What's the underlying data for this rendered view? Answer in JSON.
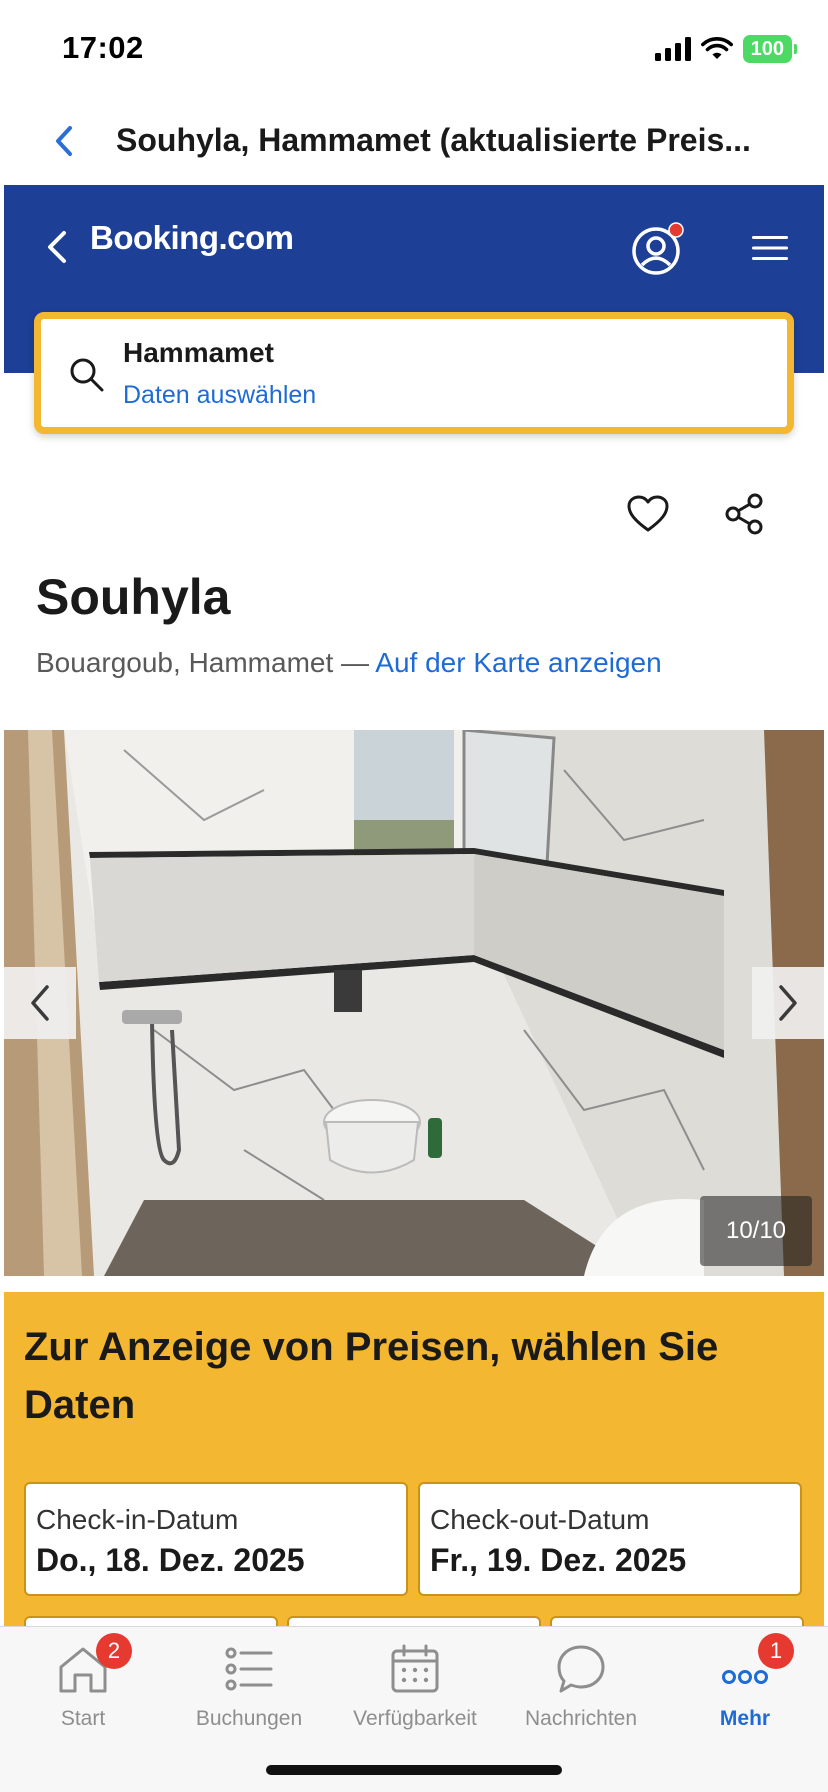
{
  "status_bar": {
    "time": "17:02",
    "battery": "100",
    "icons": [
      "cellular-signal-icon",
      "wifi-icon",
      "battery-icon"
    ]
  },
  "webview": {
    "title": "Souhyla, Hammamet (aktualisierte Preis..."
  },
  "booking_header": {
    "logo": "Booking.com",
    "background_color": "#1d3f95"
  },
  "search": {
    "destination": "Hammamet",
    "dates_prompt": "Daten auswählen",
    "border_color": "#f4b731"
  },
  "property": {
    "name": "Souhyla",
    "location": "Bouargoub, Hammamet — ",
    "map_link": "Auf der Karte anzeigen"
  },
  "gallery": {
    "counter": "10/10"
  },
  "dates": {
    "prompt": "Zur Anzeige von Preisen, wählen Sie Daten",
    "checkin_label": "Check-in-Datum",
    "checkin_value": "Do., 18. Dez. 2025",
    "checkout_label": "Check-out-Datum",
    "checkout_value": "Fr., 19. Dez. 2025",
    "panel_color": "#f4b731"
  },
  "tabs": [
    {
      "label": "Start",
      "badge": "2",
      "icon": "home-icon"
    },
    {
      "label": "Buchungen",
      "icon": "list-icon"
    },
    {
      "label": "Verfügbarkeit",
      "icon": "calendar-icon"
    },
    {
      "label": "Nachrichten",
      "icon": "chat-bubble-icon"
    },
    {
      "label": "Mehr",
      "badge": "1",
      "icon": "more-dots-icon",
      "active": true
    }
  ],
  "colors": {
    "link": "#1e6bd6",
    "badge": "#e6392f"
  }
}
